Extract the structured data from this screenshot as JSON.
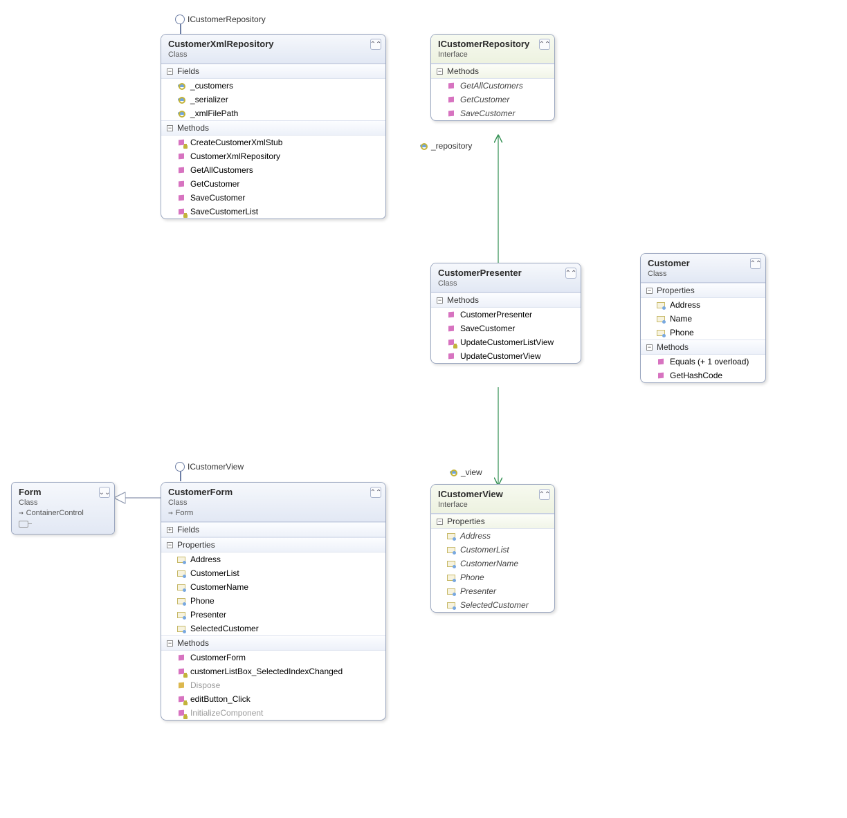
{
  "lollipops": {
    "xmlRepo": "ICustomerRepository",
    "form": "ICustomerView"
  },
  "connLabels": {
    "repository": "_repository",
    "view": "_view"
  },
  "boxes": {
    "customerXmlRepository": {
      "title": "CustomerXmlRepository",
      "stereo": "Class",
      "sections": [
        {
          "name": "Fields",
          "expanded": true,
          "items": [
            {
              "icon": "field",
              "name": "_customers"
            },
            {
              "icon": "field",
              "name": "_serializer"
            },
            {
              "icon": "field",
              "name": "_xmlFilePath"
            }
          ]
        },
        {
          "name": "Methods",
          "expanded": true,
          "items": [
            {
              "icon": "method-priv",
              "name": "CreateCustomerXmlStub"
            },
            {
              "icon": "method",
              "name": "CustomerXmlRepository"
            },
            {
              "icon": "method",
              "name": "GetAllCustomers"
            },
            {
              "icon": "method",
              "name": "GetCustomer"
            },
            {
              "icon": "method",
              "name": "SaveCustomer"
            },
            {
              "icon": "method-priv",
              "name": "SaveCustomerList"
            }
          ]
        }
      ]
    },
    "iCustomerRepository": {
      "title": "ICustomerRepository",
      "stereo": "Interface",
      "sections": [
        {
          "name": "Methods",
          "expanded": true,
          "iface": true,
          "items": [
            {
              "icon": "method",
              "name": "GetAllCustomers",
              "italic": true
            },
            {
              "icon": "method",
              "name": "GetCustomer",
              "italic": true
            },
            {
              "icon": "method",
              "name": "SaveCustomer",
              "italic": true
            }
          ]
        }
      ]
    },
    "customerPresenter": {
      "title": "CustomerPresenter",
      "stereo": "Class",
      "sections": [
        {
          "name": "Methods",
          "expanded": true,
          "items": [
            {
              "icon": "method",
              "name": "CustomerPresenter"
            },
            {
              "icon": "method",
              "name": "SaveCustomer"
            },
            {
              "icon": "method-priv",
              "name": "UpdateCustomerListView"
            },
            {
              "icon": "method",
              "name": "UpdateCustomerView"
            }
          ]
        }
      ]
    },
    "customer": {
      "title": "Customer",
      "stereo": "Class",
      "sections": [
        {
          "name": "Properties",
          "expanded": true,
          "items": [
            {
              "icon": "prop",
              "name": "Address"
            },
            {
              "icon": "prop",
              "name": "Name"
            },
            {
              "icon": "prop",
              "name": "Phone"
            }
          ]
        },
        {
          "name": "Methods",
          "expanded": true,
          "items": [
            {
              "icon": "method",
              "name": "Equals (+ 1 overload)"
            },
            {
              "icon": "method",
              "name": "GetHashCode"
            }
          ]
        }
      ]
    },
    "iCustomerView": {
      "title": "ICustomerView",
      "stereo": "Interface",
      "sections": [
        {
          "name": "Properties",
          "expanded": true,
          "iface": true,
          "items": [
            {
              "icon": "prop",
              "name": "Address",
              "italic": true
            },
            {
              "icon": "prop",
              "name": "CustomerList",
              "italic": true
            },
            {
              "icon": "prop",
              "name": "CustomerName",
              "italic": true
            },
            {
              "icon": "prop",
              "name": "Phone",
              "italic": true
            },
            {
              "icon": "prop",
              "name": "Presenter",
              "italic": true
            },
            {
              "icon": "prop",
              "name": "SelectedCustomer",
              "italic": true
            }
          ]
        }
      ]
    },
    "customerForm": {
      "title": "CustomerForm",
      "stereo": "Class",
      "inherit": "Form",
      "sections": [
        {
          "name": "Fields",
          "expanded": false,
          "items": []
        },
        {
          "name": "Properties",
          "expanded": true,
          "items": [
            {
              "icon": "prop",
              "name": "Address"
            },
            {
              "icon": "prop",
              "name": "CustomerList"
            },
            {
              "icon": "prop",
              "name": "CustomerName"
            },
            {
              "icon": "prop",
              "name": "Phone"
            },
            {
              "icon": "prop",
              "name": "Presenter"
            },
            {
              "icon": "prop",
              "name": "SelectedCustomer"
            }
          ]
        },
        {
          "name": "Methods",
          "expanded": true,
          "items": [
            {
              "icon": "method",
              "name": "CustomerForm"
            },
            {
              "icon": "method-priv",
              "name": "customerListBox_SelectedIndexChanged"
            },
            {
              "icon": "method-prot",
              "name": "Dispose",
              "dim": true
            },
            {
              "icon": "method-priv",
              "name": "editButton_Click"
            },
            {
              "icon": "method-priv",
              "name": "InitializeComponent",
              "dim": true
            }
          ]
        }
      ]
    },
    "form": {
      "title": "Form",
      "stereo": "Class",
      "inherit": "ContainerControl"
    }
  }
}
